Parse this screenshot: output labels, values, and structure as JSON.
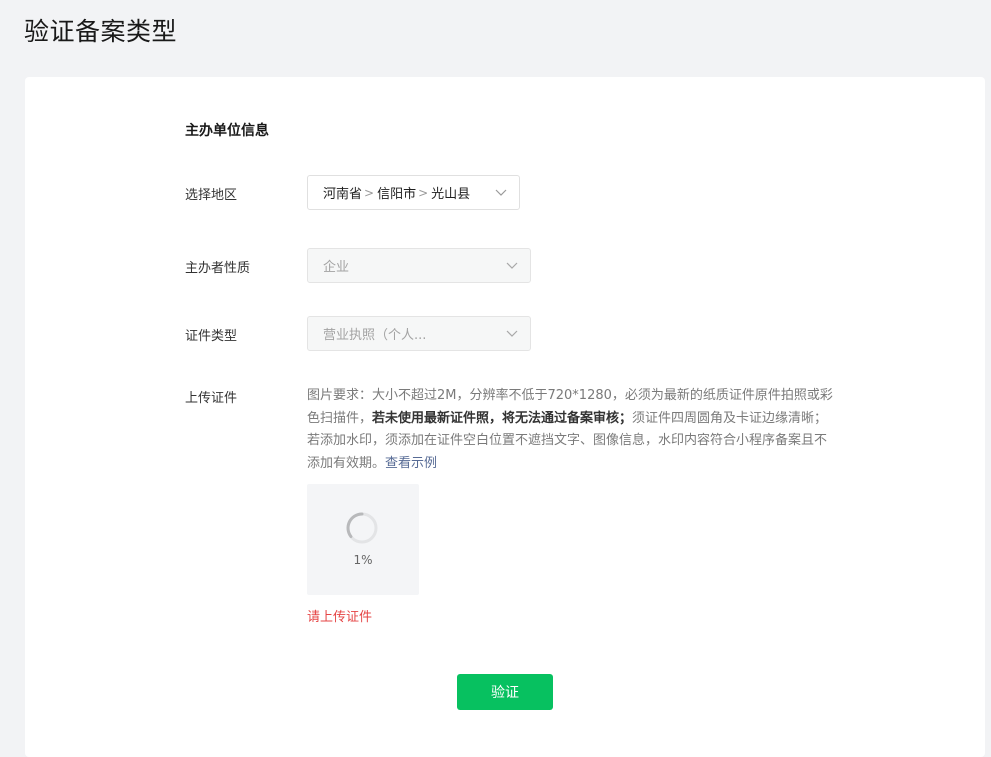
{
  "page": {
    "title": "验证备案类型"
  },
  "section": {
    "title": "主办单位信息"
  },
  "region": {
    "label": "选择地区",
    "province": "河南省",
    "city": "信阳市",
    "county": "光山县",
    "separator": ">"
  },
  "nature": {
    "label": "主办者性质",
    "value": "企业",
    "disabled": true
  },
  "cert_type": {
    "label": "证件类型",
    "value": "营业执照（个人...",
    "disabled": true
  },
  "upload": {
    "label": "上传证件",
    "desc_part1": "图片要求：大小不超过2M，分辨率不低于720*1280，必须为最新的纸质证件原件拍照或彩色扫描件，",
    "desc_bold": "若未使用最新证件照，将无法通过备案审核；",
    "desc_part2": "须证件四周圆角及卡证边缘清晰；若添加水印，须添加在证件空白位置不遮挡文字、图像信息，水印内容符合小程序备案且不添加有效期。",
    "example_link": "查看示例",
    "progress": "1%",
    "error": "请上传证件"
  },
  "actions": {
    "verify_label": "验证"
  },
  "colors": {
    "primary": "#07c160",
    "error": "#e54545",
    "link": "#576b95",
    "background": "#f2f3f5"
  },
  "icons": {
    "dropdown": "chevron-down-icon",
    "loading": "spinner-icon"
  }
}
